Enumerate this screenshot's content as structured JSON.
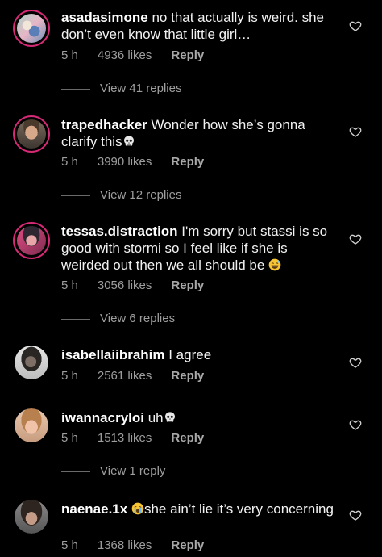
{
  "comments": [
    {
      "username": "asadasimone",
      "text": " no that actually is weird. she don’t even know that little girl…",
      "time": "5 h",
      "likes": "4936 likes",
      "reply": "Reply",
      "has_story_ring": true
    },
    {
      "username": "trapedhacker",
      "text": " Wonder how she’s gonna clarify this",
      "emoji": "skull",
      "time": "5 h",
      "likes": "3990 likes",
      "reply": "Reply",
      "has_story_ring": true
    },
    {
      "username": "tessas.distraction",
      "text": " I'm sorry but stassi is so good with stormi so I feel like if she is weirded out then we all should be",
      "emoji": "grinning-sweat",
      "time": "5 h",
      "likes": "3056 likes",
      "reply": "Reply",
      "has_story_ring": true
    },
    {
      "username": "isabellaiibrahim",
      "text": " I agree",
      "time": "5 h",
      "likes": "2561 likes",
      "reply": "Reply",
      "has_story_ring": false
    },
    {
      "username": "iwannacryloi",
      "text": " uh",
      "emoji": "skull",
      "time": "5 h",
      "likes": "1513 likes",
      "reply": "Reply",
      "has_story_ring": false
    },
    {
      "username": "naenae.1x",
      "text": "she ain’t lie it’s very concerning",
      "emoji_before_text": "crying",
      "time": "5 h",
      "likes": "1368 likes",
      "reply": "Reply",
      "has_story_ring": false
    }
  ],
  "view_replies": [
    "View 41 replies",
    "View 12 replies",
    "View 6 replies",
    "View 1 reply"
  ],
  "colors": {
    "background": "#000000",
    "text": "#f2f2f2",
    "meta": "#9e9e9e",
    "story_ring": "#d62976"
  },
  "icons": [
    "heart-outline-icon",
    "skull-emoji",
    "grinning-sweat-emoji",
    "crying-emoji"
  ]
}
